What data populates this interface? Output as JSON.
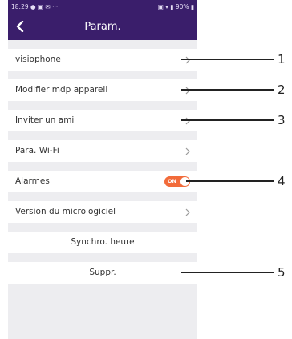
{
  "status_bar": {
    "left_text": "18:29 ● ▣ ✉ ···",
    "right_text": "▣ ▾ ▮ 90% ▮"
  },
  "app_bar": {
    "back_icon": "chevron-left-icon",
    "title": "Param."
  },
  "settings": [
    {
      "id": "visiophone",
      "label": "visiophone",
      "control": "chevron"
    },
    {
      "id": "modify-password",
      "label": "Modifier mdp appareil",
      "control": "chevron"
    },
    {
      "id": "invite-friend",
      "label": "Inviter un ami",
      "control": "chevron"
    },
    {
      "id": "wifi",
      "label": "Para. Wi-Fi",
      "control": "chevron"
    },
    {
      "id": "alarms",
      "label": "Alarmes",
      "control": "toggle",
      "toggle_text": "ON",
      "toggle_on": true
    },
    {
      "id": "firmware",
      "label": "Version du micrologiciel",
      "control": "chevron"
    },
    {
      "id": "sync-time",
      "label": "Synchro. heure",
      "control": "none",
      "align": "center"
    },
    {
      "id": "delete",
      "label": "Suppr.",
      "control": "none",
      "align": "center"
    }
  ],
  "colors": {
    "header": "#3a1e6b",
    "toggle_on": "#f26b3a",
    "background": "#ededf0",
    "callout_line": "#222222"
  },
  "callouts": [
    {
      "number": "1",
      "target": "visiophone"
    },
    {
      "number": "2",
      "target": "modify-password"
    },
    {
      "number": "3",
      "target": "invite-friend"
    },
    {
      "number": "4",
      "target": "alarms"
    },
    {
      "number": "5",
      "target": "delete"
    }
  ]
}
